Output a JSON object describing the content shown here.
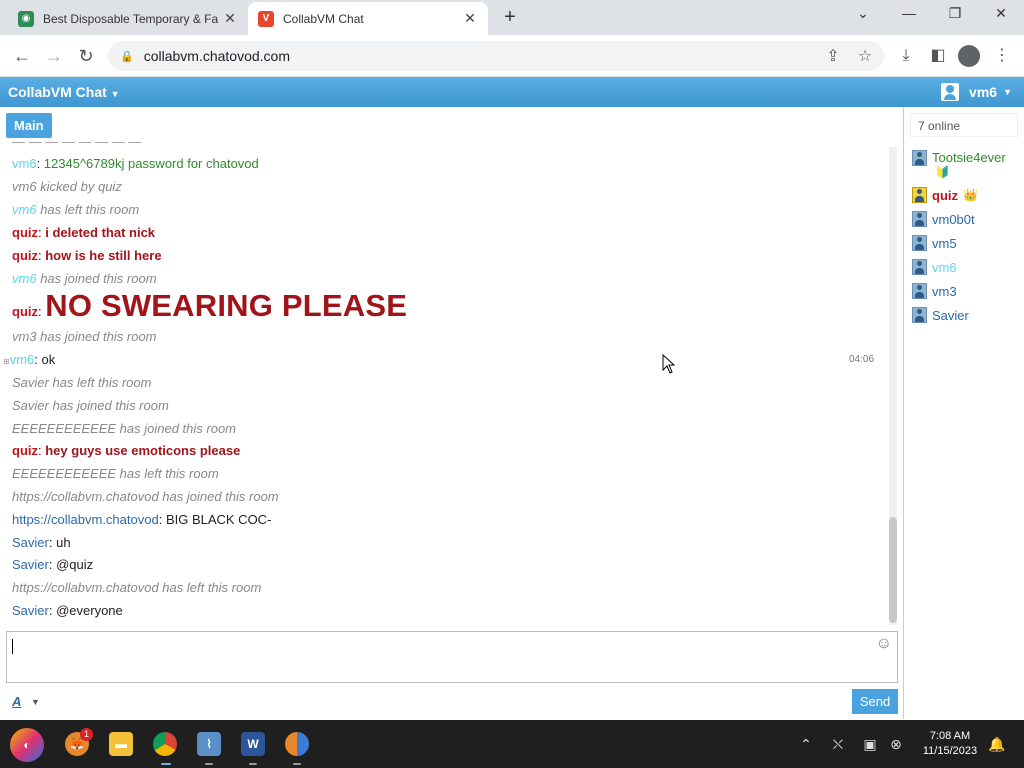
{
  "browser": {
    "tabs": [
      {
        "title": "Best Disposable Temporary & Fa",
        "active": false
      },
      {
        "title": "CollabVM Chat",
        "active": true
      }
    ],
    "url": "collabvm.chatovod.com"
  },
  "app": {
    "brand": "CollabVM Chat",
    "current_user": "vm6",
    "active_room": "Main",
    "colors": {
      "accent": "#4aa3df",
      "admin": "#c0161b",
      "guest": "#5bd3f0"
    }
  },
  "messages": [
    {
      "kind": "chat",
      "name": "vm6",
      "text": "12345^6789kj password for chatovod"
    },
    {
      "kind": "system",
      "text": "vm6 kicked by quiz"
    },
    {
      "kind": "system",
      "name": "vm6",
      "text": "has left this room"
    },
    {
      "kind": "chat",
      "name": "quiz",
      "text": "i deleted that nick"
    },
    {
      "kind": "chat",
      "name": "quiz",
      "text": "how is he still here"
    },
    {
      "kind": "system",
      "name": "vm6",
      "text": "has joined this room"
    },
    {
      "kind": "chat",
      "name": "quiz",
      "text": "NO SWEARING PLEASE"
    },
    {
      "kind": "system",
      "text": "vm3 has joined this room"
    },
    {
      "kind": "chat",
      "name": "vm6",
      "text": "ok",
      "time": "04:06"
    },
    {
      "kind": "system",
      "text": "Savier has left this room"
    },
    {
      "kind": "system",
      "text": "Savier has joined this room"
    },
    {
      "kind": "system",
      "text": "EEEEEEEEEEEE has joined this room"
    },
    {
      "kind": "chat",
      "name": "quiz",
      "text": "hey guys use emoticons please"
    },
    {
      "kind": "system",
      "text": "EEEEEEEEEEEE has left this room"
    },
    {
      "kind": "system",
      "text": "https://collabvm.chatovod has joined this room"
    },
    {
      "kind": "chat",
      "name": "https://collabvm.chatovod",
      "text": "BIG BLACK COC-"
    },
    {
      "kind": "chat",
      "name": "Savier",
      "text": "uh"
    },
    {
      "kind": "chat",
      "name": "Savier",
      "text": "@quiz"
    },
    {
      "kind": "system",
      "text": "https://collabvm.chatovod has left this room"
    },
    {
      "kind": "chat",
      "name": "Savier",
      "text": "@everyone"
    }
  ],
  "sidebar": {
    "online_count": "7 online",
    "users": [
      {
        "name": "Tootsie4ever",
        "badge": "🔰"
      },
      {
        "name": "quiz",
        "badge": "👑"
      },
      {
        "name": "vm0b0t"
      },
      {
        "name": "vm5"
      },
      {
        "name": "vm6"
      },
      {
        "name": "vm3"
      },
      {
        "name": "Savier"
      }
    ]
  },
  "composer": {
    "send_label": "Send",
    "format_label": "A"
  },
  "taskbar": {
    "time": "7:08 AM",
    "date": "11/15/2023",
    "notification_count": "1"
  }
}
